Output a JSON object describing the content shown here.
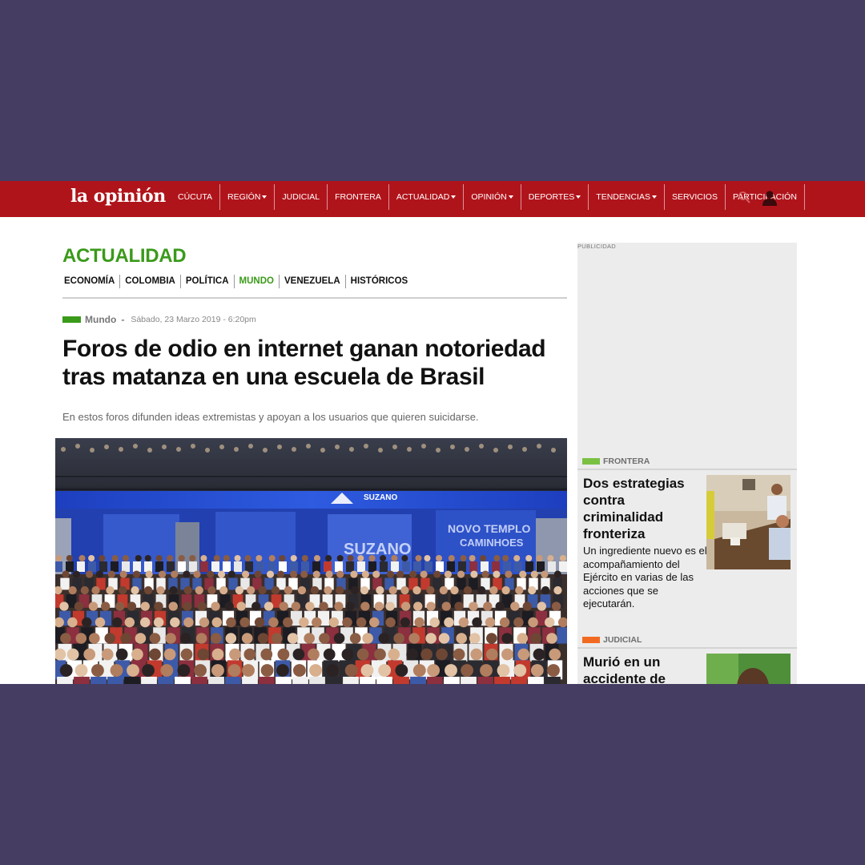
{
  "brand": {
    "logo": "la opinión",
    "accent": "#b0141b",
    "section_green": "#3a9a1a"
  },
  "nav": {
    "items": [
      {
        "label": "CÚCUTA",
        "dropdown": false
      },
      {
        "label": "REGIÓN",
        "dropdown": true
      },
      {
        "label": "JUDICIAL",
        "dropdown": false
      },
      {
        "label": "FRONTERA",
        "dropdown": false
      },
      {
        "label": "ACTUALIDAD",
        "dropdown": true
      },
      {
        "label": "OPINIÓN",
        "dropdown": true
      },
      {
        "label": "DEPORTES",
        "dropdown": true
      },
      {
        "label": "TENDENCIAS",
        "dropdown": true
      },
      {
        "label": "SERVICIOS",
        "dropdown": false
      },
      {
        "label": "PARTICIPACIÓN",
        "dropdown": false
      }
    ],
    "icons": [
      "search-icon",
      "user-icon"
    ]
  },
  "section": {
    "title": "ACTUALIDAD",
    "subnav": [
      "ECONOMÍA",
      "COLOMBIA",
      "POLÍTICA",
      "MUNDO",
      "VENEZUELA",
      "HISTÓRICOS"
    ],
    "active_subnav": "MUNDO"
  },
  "article": {
    "category": "Mundo",
    "separator": "-",
    "date": "Sábado, 23 Marzo 2019 - 6:20pm",
    "headline": "Foros de odio en internet ganan notoriedad tras matanza en una escuela de Brasil",
    "summary": "En estos foros difunden ideas extremistas y apoyan a los usuarios que quieren suicidarse.",
    "photo_banner_text": [
      "SUZANO",
      "NOVO TEMPLO",
      "CAMINHOES"
    ]
  },
  "sidebar": {
    "ad_label": "PUBLICIDAD",
    "cards": [
      {
        "category": "FRONTERA",
        "category_color": "#7ac143",
        "title": "Dos estrategias contra criminalidad fronteriza",
        "text": "Un ingrediente nuevo es el acompañamiento del Ejército en varias de las acciones que se ejecutarán."
      },
      {
        "category": "JUDICIAL",
        "category_color": "#f26a21",
        "title": "Murió en un accidente de",
        "text": ""
      }
    ]
  }
}
